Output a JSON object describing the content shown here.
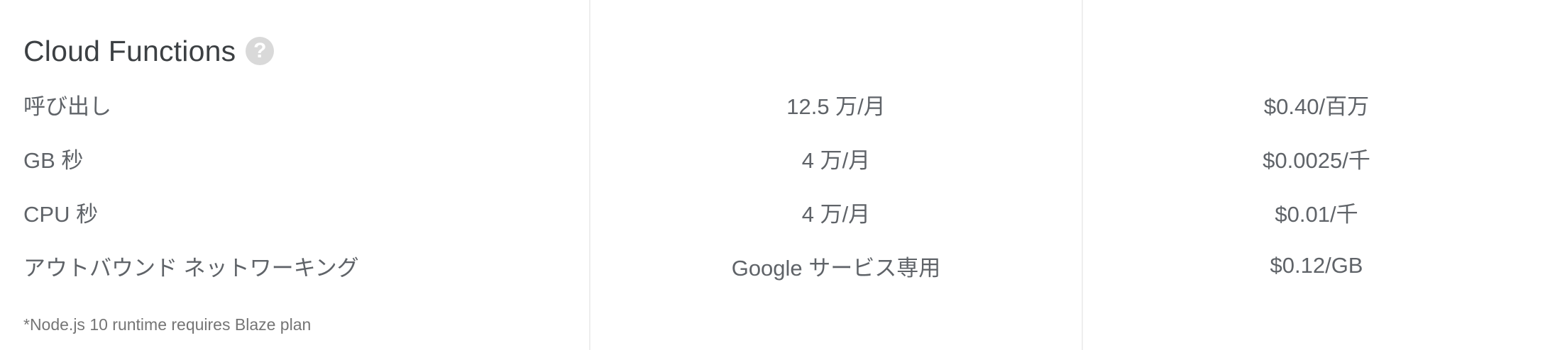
{
  "section": {
    "title": "Cloud Functions",
    "help_icon": "help-circle-icon"
  },
  "rows": [
    {
      "label": "呼び出し",
      "free_tier": "12.5 万/月",
      "price": "$0.40/百万"
    },
    {
      "label": "GB 秒",
      "free_tier": "4 万/月",
      "price": "$0.0025/千"
    },
    {
      "label": "CPU 秒",
      "free_tier": "4 万/月",
      "price": "$0.01/千"
    },
    {
      "label": "アウトバウンド ネットワーキング",
      "free_tier": "Google サービス専用",
      "price": "$0.12/GB"
    }
  ],
  "footnote": "*Node.js 10 runtime requires Blaze plan",
  "colors": {
    "title": "#3c4043",
    "text": "#5f6368",
    "divider": "#eeeeee",
    "help_icon_bg": "#d9d9d9"
  }
}
